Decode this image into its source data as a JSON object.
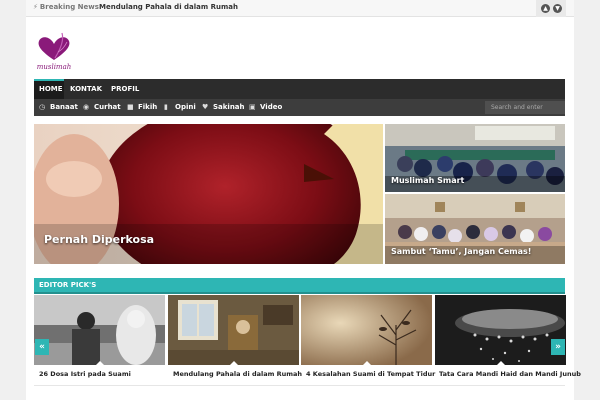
{
  "topbar": {
    "breaking_label": "Breaking News",
    "ticker_text": "Mendulang Pahala di dalam Rumah"
  },
  "logo": {
    "text": "muslimah"
  },
  "main_nav": [
    {
      "label": "HOME"
    },
    {
      "label": "KONTAK"
    },
    {
      "label": "PROFIL"
    }
  ],
  "sub_nav": [
    {
      "label": "Banaat",
      "icon": "clock-icon"
    },
    {
      "label": "Curhat",
      "icon": "eye-icon"
    },
    {
      "label": "Fikih",
      "icon": "book-icon"
    },
    {
      "label": "Opini",
      "icon": "comment-icon"
    },
    {
      "label": "Sakinah",
      "icon": "heart-icon"
    },
    {
      "label": "Video",
      "icon": "video-icon"
    }
  ],
  "search": {
    "placeholder": "Search and enter"
  },
  "hero": {
    "main": "Pernah Diperkosa",
    "side1": "Muslimah Smart",
    "side2": "Sambut ‘Tamu’, Jangan Cemas!"
  },
  "editor_picks": {
    "title": "EDITOR PICK'S",
    "items": [
      {
        "caption": "26 Dosa Istri pada Suami"
      },
      {
        "caption": "Mendulang Pahala di dalam Rumah"
      },
      {
        "caption": "4 Kesalahan Suami di Tempat Tidur"
      },
      {
        "caption": "Tata Cara Mandi Haid dan Mandi Junub"
      }
    ]
  },
  "colors": {
    "accent": "#2eb6b4",
    "nav_dark": "#2c2c2c",
    "logo": "#8a1a7a"
  }
}
